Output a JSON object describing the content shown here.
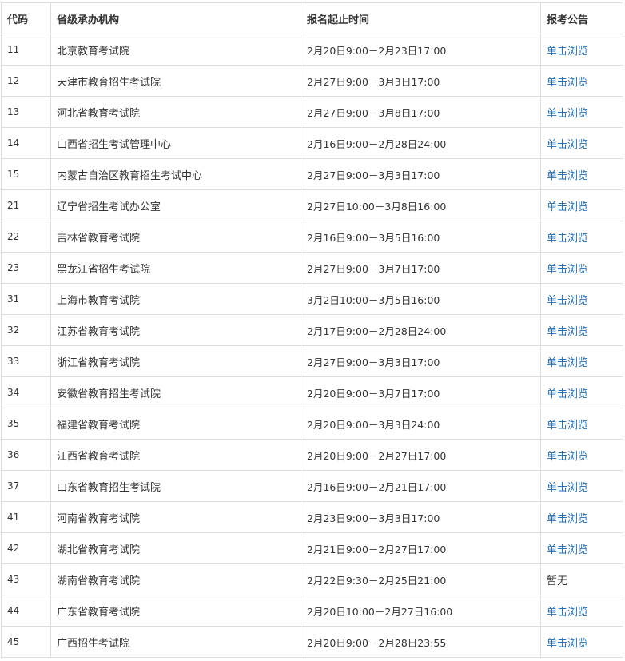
{
  "table": {
    "headers": {
      "code": "代码",
      "org": "省级承办机构",
      "time": "报名起止时间",
      "announcement": "报考公告"
    },
    "rows": [
      {
        "code": "11",
        "org": "北京教育考试院",
        "time": "2月20日9:00－2月23日17:00",
        "announcement": "单击浏览",
        "link": true
      },
      {
        "code": "12",
        "org": "天津市教育招生考试院",
        "time": "2月27日9:00－3月3日17:00",
        "announcement": "单击浏览",
        "link": true
      },
      {
        "code": "13",
        "org": "河北省教育考试院",
        "time": "2月27日9:00－3月8日17:00",
        "announcement": "单击浏览",
        "link": true
      },
      {
        "code": "14",
        "org": "山西省招生考试管理中心",
        "time": "2月16日9:00－2月28日24:00",
        "announcement": "单击浏览",
        "link": true
      },
      {
        "code": "15",
        "org": "内蒙古自治区教育招生考试中心",
        "time": "2月27日9:00－3月3日17:00",
        "announcement": "单击浏览",
        "link": true
      },
      {
        "code": "21",
        "org": "辽宁省招生考试办公室",
        "time": "2月27日10:00－3月8日16:00",
        "announcement": "单击浏览",
        "link": true
      },
      {
        "code": "22",
        "org": "吉林省教育考试院",
        "time": "2月16日9:00－3月5日16:00",
        "announcement": "单击浏览",
        "link": true
      },
      {
        "code": "23",
        "org": "黑龙江省招生考试院",
        "time": "2月27日9:00－3月7日17:00",
        "announcement": "单击浏览",
        "link": true
      },
      {
        "code": "31",
        "org": "上海市教育考试院",
        "time": "3月2日10:00－3月5日16:00",
        "announcement": "单击浏览",
        "link": true
      },
      {
        "code": "32",
        "org": "江苏省教育考试院",
        "time": "2月17日9:00－2月28日24:00",
        "announcement": "单击浏览",
        "link": true
      },
      {
        "code": "33",
        "org": "浙江省教育考试院",
        "time": "2月27日9:00－3月3日17:00",
        "announcement": "单击浏览",
        "link": true
      },
      {
        "code": "34",
        "org": "安徽省教育招生考试院",
        "time": "2月20日9:00－3月7日17:00",
        "announcement": "单击浏览",
        "link": true
      },
      {
        "code": "35",
        "org": "福建省教育考试院",
        "time": "2月20日9:00－3月3日24:00",
        "announcement": "单击浏览",
        "link": true
      },
      {
        "code": "36",
        "org": "江西省教育考试院",
        "time": "2月20日9:00－2月27日17:00",
        "announcement": "单击浏览",
        "link": true
      },
      {
        "code": "37",
        "org": "山东省教育招生考试院",
        "time": "2月16日9:00－2月21日17:00",
        "announcement": "单击浏览",
        "link": true
      },
      {
        "code": "41",
        "org": "河南省教育考试院",
        "time": "2月23日9:00－3月3日17:00",
        "announcement": "单击浏览",
        "link": true
      },
      {
        "code": "42",
        "org": "湖北省教育考试院",
        "time": "2月21日9:00－2月27日17:00",
        "announcement": "单击浏览",
        "link": true
      },
      {
        "code": "43",
        "org": "湖南省教育考试院",
        "time": "2月22日9:30－2月25日21:00",
        "announcement": "暂无",
        "link": false
      },
      {
        "code": "44",
        "org": "广东省教育考试院",
        "time": "2月20日10:00－2月27日16:00",
        "announcement": "单击浏览",
        "link": true
      },
      {
        "code": "45",
        "org": "广西招生考试院",
        "time": "2月20日9:00－2月28日23:55",
        "announcement": "单击浏览",
        "link": true
      }
    ]
  },
  "colors": {
    "link": "#2a6fb0",
    "text": "#333333",
    "border": "#dddddd"
  }
}
